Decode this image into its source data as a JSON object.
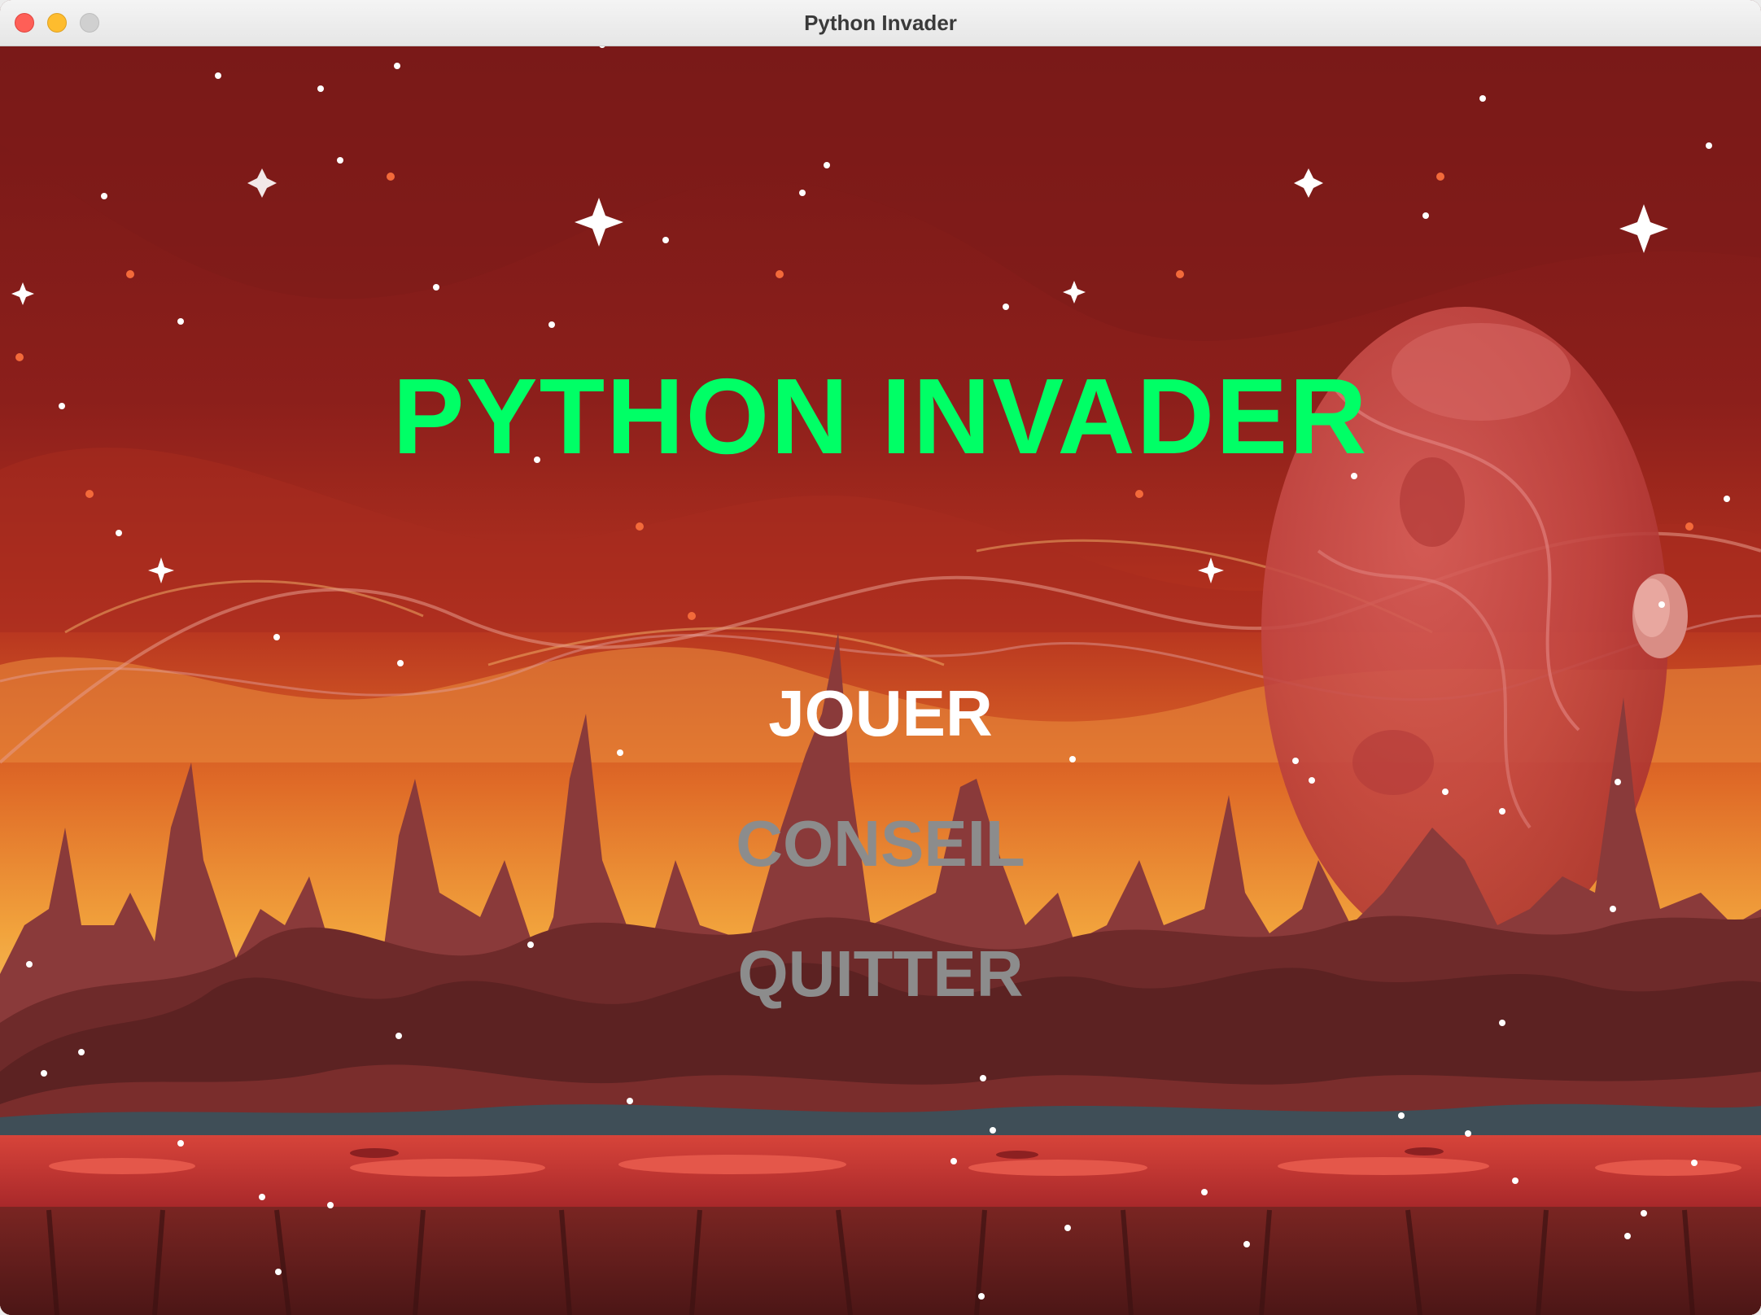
{
  "window": {
    "title": "Python Invader"
  },
  "game": {
    "title": "PYTHON INVADER",
    "title_color": "#00ff66",
    "menu": [
      {
        "label": "JOUER",
        "state": "selected",
        "color": "#ffffff"
      },
      {
        "label": "CONSEIL",
        "state": "normal",
        "color": "#8c8c8c"
      },
      {
        "label": "QUITTER",
        "state": "normal",
        "color": "#8c8c8c"
      }
    ],
    "palette": {
      "sky_top": "#7a1a18",
      "sky_mid": "#b8321f",
      "horizon": "#f0a23c",
      "rock": "#8e3a36",
      "rock_dark": "#4a1c1c",
      "lava": "#c4332c",
      "planet": "#c94a48"
    }
  }
}
